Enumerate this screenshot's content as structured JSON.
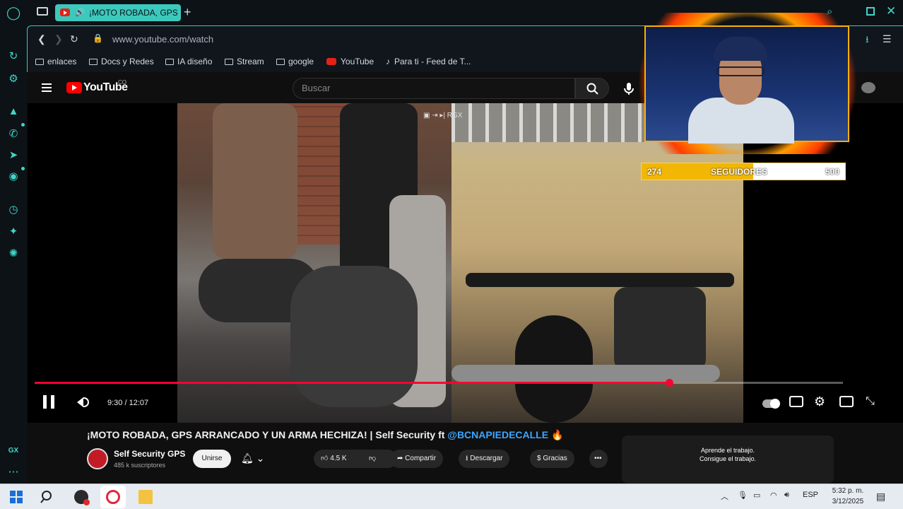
{
  "browser": {
    "tab_title": "¡MOTO ROBADA, GPS",
    "url": "www.youtube.com/watch",
    "bookmarks": [
      "enlaces",
      "Docs y Redes",
      "IA diseño",
      "Stream",
      "google",
      "YouTube",
      "Para ti - Feed de T..."
    ],
    "sidebar_label": "GX"
  },
  "youtube": {
    "logo": "YouTube",
    "logo_badge": "CO",
    "search_placeholder": "Buscar",
    "player": {
      "time": "9:30 / 12:07",
      "progress": 0.785,
      "overlay_icons": [
        "RGX"
      ]
    },
    "video": {
      "title_prefix": "¡MOTO ROBADA, GPS ARRANCADO Y UN ARMA HECHIZA! | Self Security ft ",
      "title_mention": "@BCNAPIEDECALLE",
      "title_suffix": " 🔥"
    },
    "channel": {
      "name": "Self Security GPS",
      "subscribers": "485 k suscriptores",
      "join_label": "Unirse"
    },
    "actions": {
      "likes": "4.5 K",
      "share": "Compartir",
      "download": "Descargar",
      "thanks": "Gracias"
    },
    "promo": {
      "line1": "Aprende el trabajo.",
      "line2": "Consigue el trabajo."
    }
  },
  "stream_overlay": {
    "followers_current": "274",
    "followers_label": "SEGUIDORES",
    "followers_goal": "500",
    "followers_fraction": 0.548
  },
  "taskbar": {
    "language": "ESP",
    "time": "5:32 p. m.",
    "date": "3/12/2025"
  },
  "colors": {
    "opera_accent": "#3cc9bd",
    "youtube_red": "#ff0033",
    "mention_blue": "#3ea6ff",
    "follower_bar": "#f2b705"
  }
}
